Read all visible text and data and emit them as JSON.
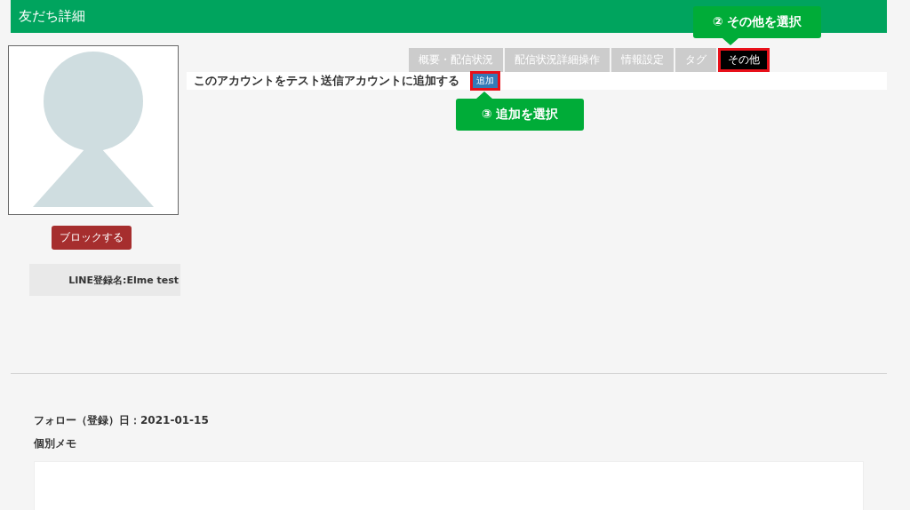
{
  "header": {
    "title": "友だち詳細"
  },
  "profile": {
    "block_button": "ブロックする",
    "line_name_label": "LINE登録名:",
    "line_name": "Elme test"
  },
  "tabs": [
    {
      "label": "概要・配信状況",
      "selected": false,
      "highlighted": false
    },
    {
      "label": "配信状況詳細操作",
      "selected": false,
      "highlighted": false
    },
    {
      "label": "情報設定",
      "selected": false,
      "highlighted": false
    },
    {
      "label": "タグ",
      "selected": false,
      "highlighted": false
    },
    {
      "label": "その他",
      "selected": true,
      "highlighted": true
    }
  ],
  "test_account": {
    "text": "このアカウントをテスト送信アカウントに追加する",
    "button": "追加",
    "highlighted": true
  },
  "callouts": [
    {
      "text": "② その他を選択",
      "kind": "above"
    },
    {
      "text": "③ 追加を選択",
      "kind": "below"
    }
  ],
  "details": {
    "follow_date": "フォロー（登録）日：2021-01-15",
    "memo_label": "個別メモ"
  }
}
